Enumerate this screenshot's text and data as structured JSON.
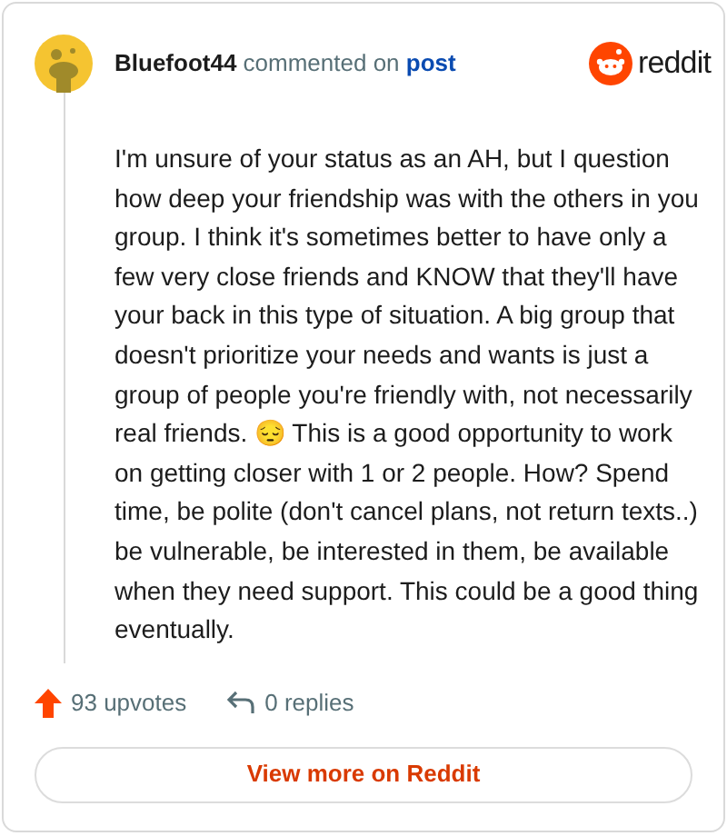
{
  "header": {
    "author": "Bluefoot44",
    "action": "commented on",
    "link": "post",
    "brand": "reddit"
  },
  "comment": "I'm unsure of your status as an AH, but I question how deep your friendship was with the others in you group. I think it's sometimes better to have only a few very close friends and KNOW that they'll have your back in this type of situation. A big group that doesn't prioritize your needs and wants is just a group of people you're friendly with, not necessarily real friends. 😔 This is a good opportunity to work on getting closer with 1 or 2 people. How? Spend time, be polite (don't cancel plans, not return texts..) be vulnerable, be interested in them, be available when they need support. This could be a good thing eventually.",
  "stats": {
    "upvotes": "93 upvotes",
    "replies": "0 replies"
  },
  "button": "View more on Reddit"
}
